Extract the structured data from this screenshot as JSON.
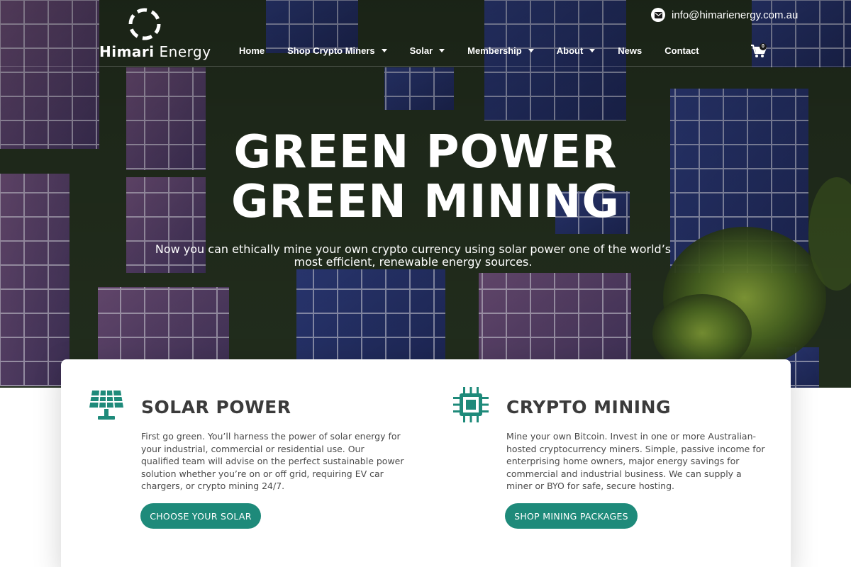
{
  "header": {
    "logo_bold": "Himari",
    "logo_light": "Energy",
    "email": "info@himarienergy.com.au",
    "cart_count": "0"
  },
  "nav": {
    "items": [
      {
        "label": "Home",
        "has_dropdown": false
      },
      {
        "label": "Shop Crypto Miners",
        "has_dropdown": true
      },
      {
        "label": "Solar",
        "has_dropdown": true
      },
      {
        "label": "Membership",
        "has_dropdown": true
      },
      {
        "label": "About",
        "has_dropdown": true
      },
      {
        "label": "News",
        "has_dropdown": false
      },
      {
        "label": "Contact",
        "has_dropdown": false
      }
    ]
  },
  "hero": {
    "title_line1": "GREEN POWER",
    "title_line2": "GREEN MINING",
    "subtitle": "Now you can ethically mine your own crypto currency using solar power one of the world’s most efficient, renewable energy sources."
  },
  "features": [
    {
      "icon": "solar-panel-icon",
      "title": "SOLAR POWER",
      "text": "First go green. You’ll harness the power of solar energy for your industrial, commercial or residential use. Our qualified team will advise on the perfect sustainable power solution whether you’re on or off grid, requiring EV car chargers, or crypto mining 24/7.",
      "button": "CHOOSE YOUR SOLAR"
    },
    {
      "icon": "chip-icon",
      "title": "CRYPTO MINING",
      "text": "Mine your own Bitcoin. Invest in one or more Australian-hosted cryptocurrency miners. Simple, passive income for enterprising home owners, major energy savings for commercial and industrial business. We can supply a miner or BYO for safe, secure hosting.",
      "button": "SHOP MINING PACKAGES"
    }
  ],
  "colors": {
    "accent": "#1e8a7a",
    "heading": "#3b3b3b",
    "body_text": "#4a4a4a"
  }
}
